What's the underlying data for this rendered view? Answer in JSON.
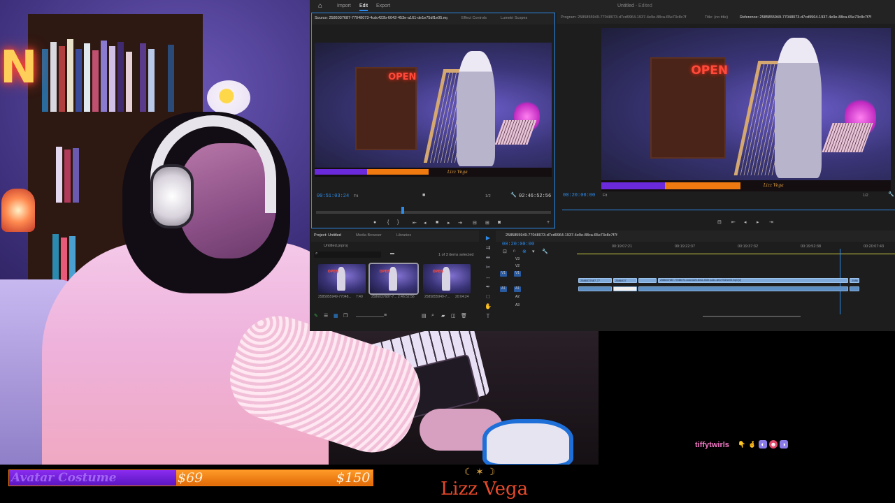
{
  "premiere": {
    "tabs": [
      "Import",
      "Edit",
      "Export"
    ],
    "active_tab": "Edit",
    "project_title": "Untitled",
    "project_status": "- Edited",
    "source_panel": {
      "tabs": [
        "Source: 2586037687-77048073-4cdc422b-6042-453e-a161-de1e75df1e05.mp4",
        "Effect Controls",
        "Lumetri Scopes"
      ],
      "timecode_in": "00:51:03:24",
      "timecode_dur": "02:46:52:56",
      "fit": "Fit",
      "ratio": "1/2"
    },
    "program_panel": {
      "tabs": [
        "Program: 2585855949-77048073-d7cd9964-1937-4e9e-88ca-65e73c8c7f7f",
        "Title: (no title)",
        "Reference: 2585855949-77048073-d7cd9964-1937-4e9e-88ca-65e73c8c7f7f"
      ],
      "timecode": "00:20:00:00",
      "fit": "Fit",
      "ratio": "1/2"
    },
    "project_panel": {
      "tabs": [
        "Project: Untitled",
        "Media Browser",
        "Libraries"
      ],
      "file": "Untitled.prproj",
      "selection": "1 of 3 items selected",
      "items": [
        {
          "name": "2585855949-77048...",
          "duration": "7:40"
        },
        {
          "name": "2586037687-7...",
          "duration": "2:46:52:56"
        },
        {
          "name": "2585855949-7...",
          "duration": "20:04:24"
        }
      ]
    },
    "timeline": {
      "sequence": "2585855949-77048073-d7cd9964-1937-4e9e-88ca-65e73c8c7f7f",
      "timecode": "00:20:00:00",
      "ruler": [
        "00:19:07:21",
        "00:19:22:37",
        "00:19:37:32",
        "00:19:52:38",
        "00:20:07:43"
      ],
      "video_tracks": [
        "V3",
        "V2",
        "V1"
      ],
      "audio_tracks": [
        "A1",
        "A2",
        "A3"
      ],
      "clip_label_1": "2586037687-77",
      "clip_label_2": "2586037",
      "clip_label_3": "2586037687-77048073-4cdc422b-6042-453e-a161-de1e75df1e05.mp4 [V]",
      "clip_label_4": "2586"
    },
    "overlay_name": "Lizz Vega",
    "overlay_goal": "Avatar Costume"
  },
  "stream": {
    "goal_title": "Avatar Costume",
    "goal_current": "$69",
    "goal_target": "$150",
    "goal_progress": 0.46,
    "brand": "Lizz Vega",
    "chat_user": "tiffytwirls",
    "chat_emotes": [
      "point-down-emote",
      "hand-emote",
      "purple-emote",
      "face-emote",
      "purple-emote-2"
    ],
    "colors": {
      "goal_purple": "#7a22e8",
      "goal_orange": "#f07a10",
      "brand_red": "#e84a2a",
      "chat_pink": "#f57ac8",
      "premiere_blue": "#2d8ceb"
    }
  }
}
